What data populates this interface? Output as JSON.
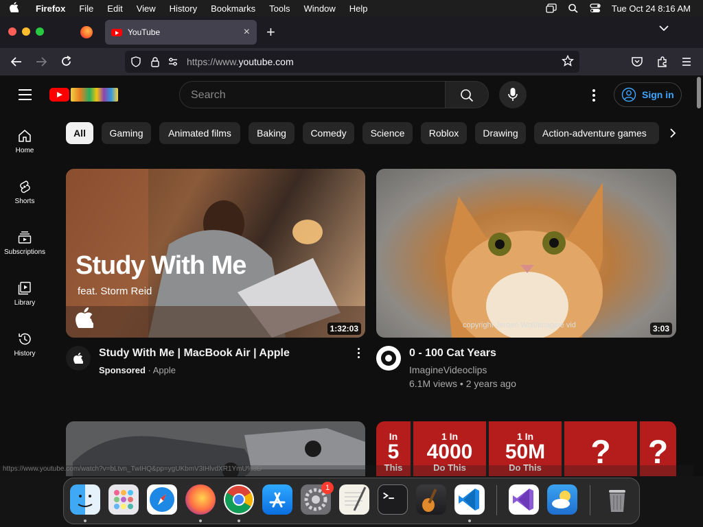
{
  "menubar": {
    "app_name": "Firefox",
    "items": [
      "File",
      "Edit",
      "View",
      "History",
      "Bookmarks",
      "Tools",
      "Window",
      "Help"
    ],
    "clock": "Tue Oct 24  8:16 AM"
  },
  "browser": {
    "tab_title": "YouTube",
    "url_prefix": "https://www.",
    "url_domain": "youtube.com",
    "new_tab_glyph": "+",
    "close_glyph": "×"
  },
  "youtube": {
    "search_placeholder": "Search",
    "sign_in_label": "Sign in",
    "sidebar": [
      {
        "label": "Home",
        "icon": "home-icon"
      },
      {
        "label": "Shorts",
        "icon": "shorts-icon"
      },
      {
        "label": "Subscriptions",
        "icon": "subscriptions-icon"
      },
      {
        "label": "Library",
        "icon": "library-icon"
      },
      {
        "label": "History",
        "icon": "history-icon"
      }
    ],
    "chips": [
      "All",
      "Gaming",
      "Animated films",
      "Baking",
      "Comedy",
      "Science",
      "Roblox",
      "Drawing",
      "Action-adventure games"
    ],
    "videos": [
      {
        "thumb_title": "Study With Me",
        "thumb_subtitle": "feat. Storm Reid",
        "duration": "1:32:03",
        "title": "Study With Me | MacBook Air | Apple",
        "sponsored": "Sponsored",
        "channel": "Apple"
      },
      {
        "thumb_watermark": "copyright Jeroen Wolf/imagine vid",
        "duration": "3:03",
        "title": "0 - 100 Cat Years",
        "channel": "ImagineVideoclips",
        "stats": "6.1M views • 2 years ago"
      }
    ],
    "row2_panels": [
      {
        "top": "In",
        "big": "5",
        "bottom": "This"
      },
      {
        "top": "1 In",
        "big": "4000",
        "bottom": "Do This"
      },
      {
        "top": "1 In",
        "big": "50M",
        "bottom": "Do This"
      },
      {
        "top": "",
        "big": "?",
        "bottom": ""
      },
      {
        "top": "",
        "big": "?",
        "bottom": ""
      }
    ],
    "status_url": "https://www.youtube.com/watch?v=bLtvn_TwIHQ&pp=ygUKbmV3IHlvdXR1YmU%3D"
  },
  "dock": {
    "apps": [
      "Finder",
      "Launchpad",
      "Safari",
      "Firefox",
      "Chrome",
      "App Store",
      "System Settings",
      "TextEdit",
      "Terminal",
      "GarageBand",
      "VS Code",
      "Visual Studio",
      "Weather",
      "Trash"
    ],
    "settings_badge": "1"
  },
  "colors": {
    "yt_background": "#0f0f0f",
    "yt_red": "#ff0000",
    "link_blue": "#3ea6ff",
    "chip_bg": "#272727"
  }
}
